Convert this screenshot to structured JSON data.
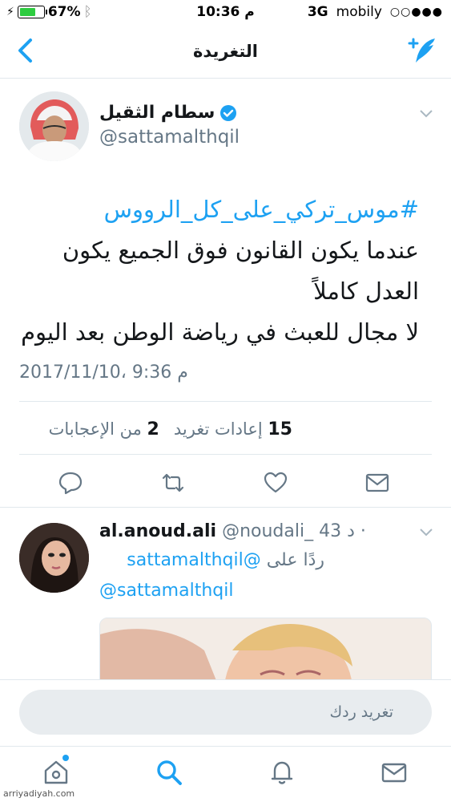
{
  "status_bar": {
    "battery": "67%",
    "time": "10:36 م",
    "network": "3G",
    "carrier": "mobily",
    "signal": "○○●●●"
  },
  "nav": {
    "title": "التغريدة",
    "back_icon": "chevron-left-icon",
    "compose_icon": "compose-tweet-icon"
  },
  "tweet": {
    "author_name": "سطام الثقيل",
    "author_handle": "@sattamalthqil",
    "hashtag": "#موس_تركي_على_كل_الرووس",
    "lines": [
      "عندما يكون القانون فوق الجميع يكون",
      "العدل كاملاً",
      "لا مجال للعبث في رياضة الوطن بعد اليوم"
    ],
    "timestamp": "2017/11/10، 9:36 م",
    "stats": {
      "retweets_count": "15",
      "retweets_label": "إعادات تغريد",
      "likes_count": "2",
      "likes_label": "من الإعجابات"
    },
    "accent": "#1da1f2"
  },
  "reply": {
    "author_name": "al.anoud.ali",
    "author_handle": "@noudali_",
    "time_ago": "43 د ·",
    "replying_label": "ردًا على",
    "replying_mention": "@sattamalthqil",
    "mention": "@sattamalthqil"
  },
  "composer": {
    "placeholder": "تغريد ردك"
  },
  "tabbar": {
    "items": [
      "home-icon",
      "search-icon",
      "notifications-icon",
      "messages-icon"
    ]
  },
  "watermark": "arriyadiyah.com"
}
